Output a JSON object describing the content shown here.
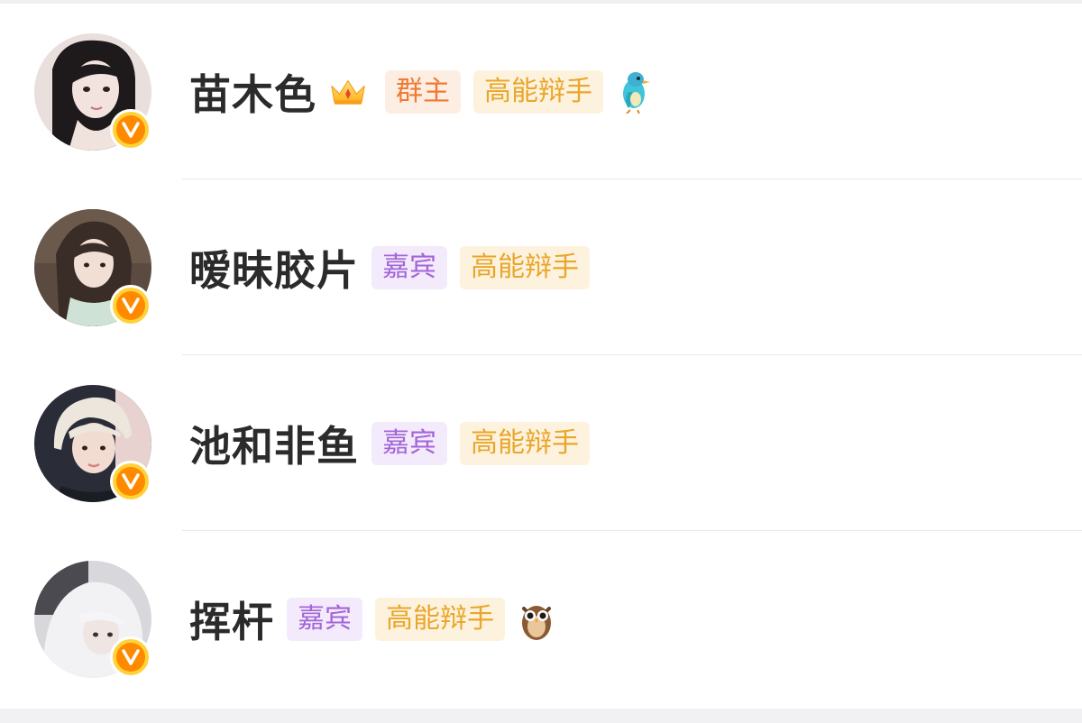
{
  "members": [
    {
      "name": "苗木色",
      "has_crown": true,
      "tags": [
        {
          "label": "群主",
          "style": "owner"
        },
        {
          "label": "高能辩手",
          "style": "debater"
        }
      ],
      "trailing_icon": "bird-icon",
      "verified": true
    },
    {
      "name": "暧昧胶片",
      "has_crown": false,
      "tags": [
        {
          "label": "嘉宾",
          "style": "guest"
        },
        {
          "label": "高能辩手",
          "style": "debater"
        }
      ],
      "trailing_icon": null,
      "verified": true
    },
    {
      "name": "池和非鱼",
      "has_crown": false,
      "tags": [
        {
          "label": "嘉宾",
          "style": "guest"
        },
        {
          "label": "高能辩手",
          "style": "debater"
        }
      ],
      "trailing_icon": null,
      "verified": true
    },
    {
      "name": "挥杆",
      "has_crown": false,
      "tags": [
        {
          "label": "嘉宾",
          "style": "guest"
        },
        {
          "label": "高能辩手",
          "style": "debater"
        }
      ],
      "trailing_icon": "owl-icon",
      "verified": true
    }
  ],
  "colors": {
    "owner_tag_bg": "#fdeee3",
    "owner_tag_text": "#f07a32",
    "guest_tag_bg": "#f3ebfb",
    "guest_tag_text": "#a365d8",
    "debater_tag_bg": "#fdf2dd",
    "debater_tag_text": "#e9a62a",
    "verified_badge": "#ff8a00"
  }
}
